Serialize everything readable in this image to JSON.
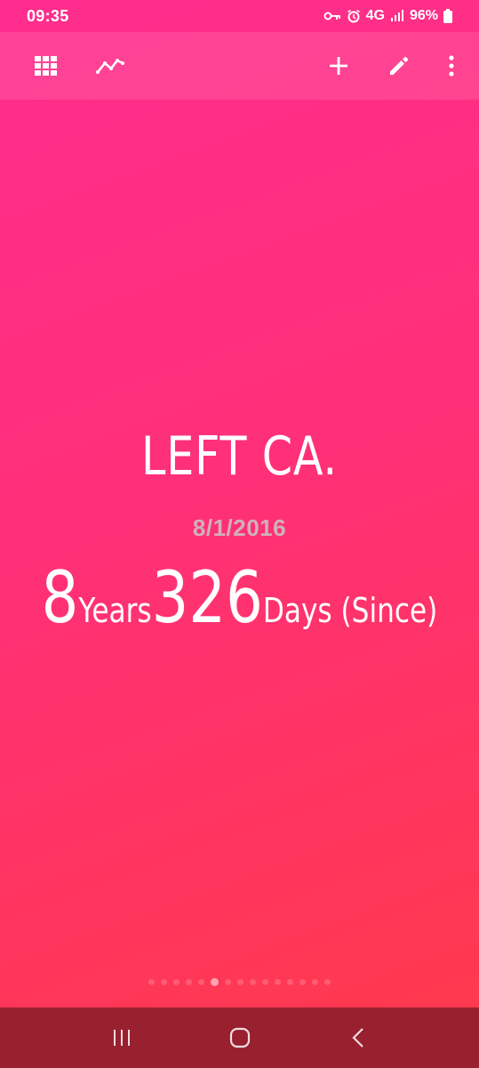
{
  "status_bar": {
    "time": "09:35",
    "network": "4G",
    "battery": "96%",
    "icons": [
      "vpn-key-icon",
      "alarm-icon",
      "network-4g-icon",
      "signal-icon",
      "battery-icon"
    ]
  },
  "app_bar": {
    "icons": [
      "grid-icon",
      "trend-chart-icon",
      "add-icon",
      "edit-icon",
      "more-vert-icon"
    ]
  },
  "event": {
    "title": "LEFT CA.",
    "date": "8/1/2016",
    "years_value": "8",
    "years_label": "Years",
    "days_value": "326",
    "days_label": "Days (Since)"
  },
  "pager": {
    "total": 15,
    "active_index": 5
  },
  "nav_bar": {
    "icons": [
      "recents-icon",
      "home-icon",
      "back-icon"
    ]
  },
  "colors": {
    "gradient_start": "#ff2d8e",
    "gradient_end": "#ff3a4a",
    "nav_bar": "#98202f",
    "date_text": "#c8c8c8"
  }
}
